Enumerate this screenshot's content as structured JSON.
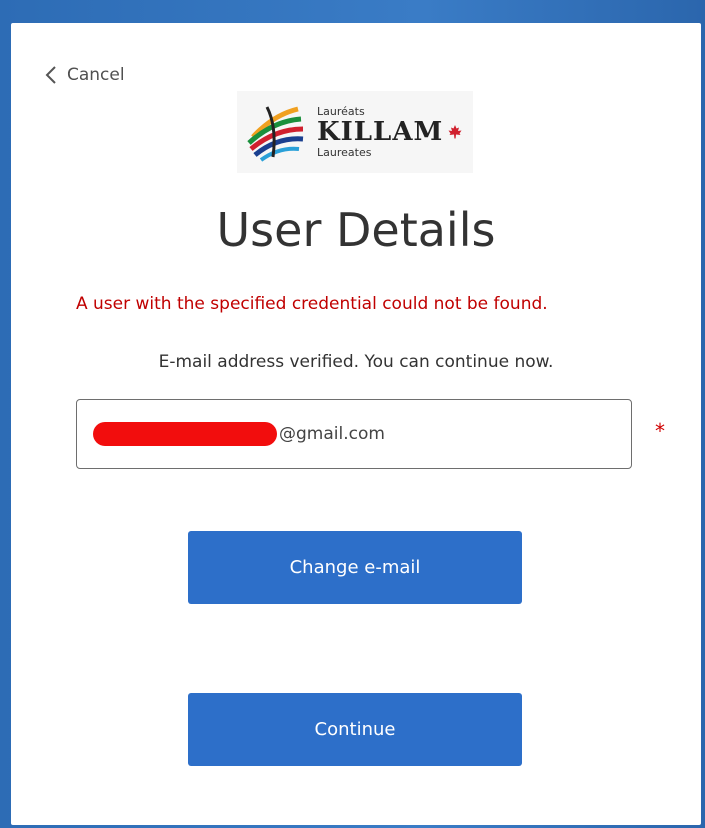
{
  "nav": {
    "cancel_label": "Cancel",
    "cancel_icon": "chevron-left-icon"
  },
  "logo": {
    "text_top": "Lauréats",
    "text_main": "KILLAM",
    "text_bottom": "Laureates",
    "leaf_icon": "maple-leaf-icon",
    "leaf_color": "#d0202e"
  },
  "page": {
    "title": "User Details",
    "error_message": "A user with the specified credential could not be found.",
    "info_message": "E-mail address verified. You can continue now."
  },
  "email_field": {
    "value_suffix": "@gmail.com",
    "redacted": true,
    "required_marker": "*"
  },
  "buttons": {
    "change_email": "Change e-mail",
    "continue": "Continue"
  },
  "colors": {
    "accent": "#2d6fc9",
    "error": "#c00000",
    "frame": "#2f6fb8"
  }
}
